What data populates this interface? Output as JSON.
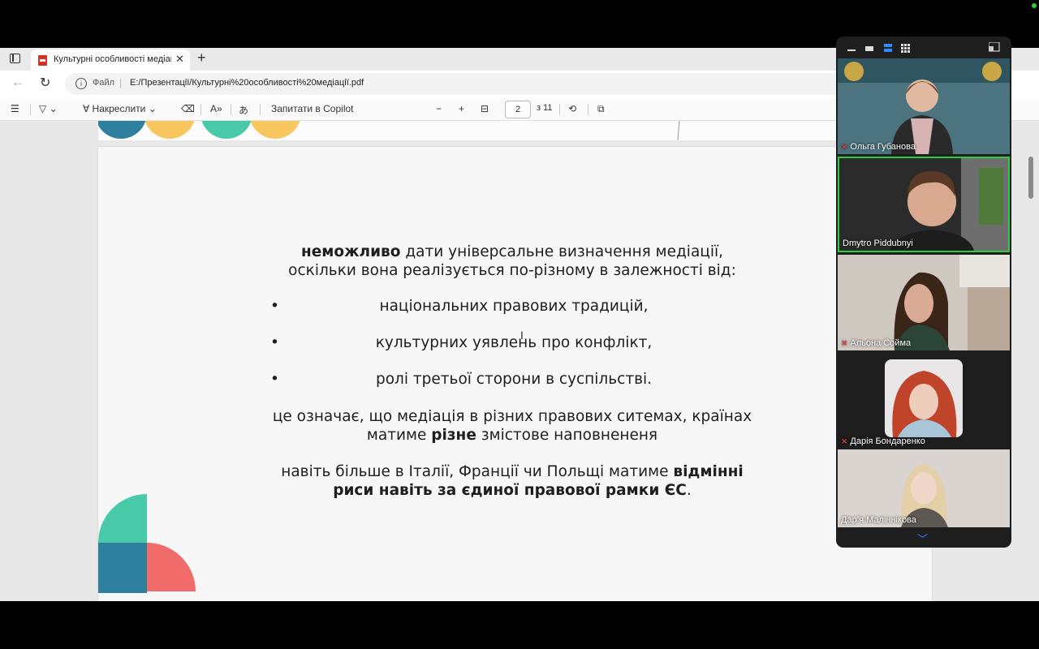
{
  "browser": {
    "tab_title": "Культурні особливості медіації.pdf",
    "file_label": "Файл",
    "url": "E:/Презентації/Культурні%20особливості%20медіації.pdf"
  },
  "pdf_toolbar": {
    "draw_label": "Накреслити",
    "copilot_label": "Запитати в Copilot",
    "current_page": "2",
    "total_pages": "з 11"
  },
  "slide": {
    "intro_bold": "неможливо",
    "intro_rest_line1": " дати універсальне визначення медіації,",
    "intro_line2": "оскільки вона реалізується по-різному в залежності від:",
    "bullets": [
      "національних правових традицій,",
      "культурних уявлень про конфлікт,",
      "ролі третьої сторони в суспільстві."
    ],
    "meaning_line1": "це означає, що медіація в різних правових ситемах, країнах",
    "meaning_pre": "матиме ",
    "meaning_bold": "різне",
    "meaning_post": " змістове наповнененя",
    "final_pre": "навіть більше в Італії, Франції чи Польщі матиме ",
    "final_bold1": "відмінні",
    "final_bold2": "риси навіть за єдиної правової рамки ЄС",
    "final_post": "."
  },
  "participants": [
    {
      "name": "Ольга Губанова",
      "muted": true
    },
    {
      "name": "Dmytro Piddubnyi",
      "muted": false,
      "active_speaker": true
    },
    {
      "name": "Альона Сойма",
      "muted": true
    },
    {
      "name": "Дарія Бондаренко",
      "muted": true
    },
    {
      "name": "Дар’я Маліннікова",
      "muted": false
    }
  ],
  "colors": {
    "slide_teal": "#48c9a8",
    "slide_blue": "#2f7f9e",
    "slide_coral": "#f26b6b",
    "slide_yellow": "#f7c65f",
    "speaker_border": "#2ecc40",
    "mic_off": "#e53935"
  }
}
